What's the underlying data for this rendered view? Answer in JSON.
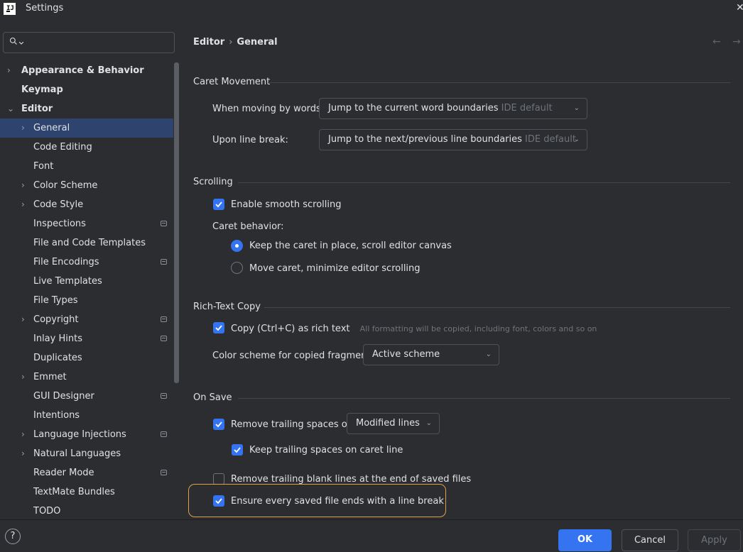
{
  "window": {
    "title": "Settings",
    "close": "✕"
  },
  "search": {
    "value": ""
  },
  "tree": [
    {
      "label": "Appearance & Behavior",
      "bold": true,
      "arrow": "›",
      "level": 0
    },
    {
      "label": "Keymap",
      "bold": true,
      "arrow": "",
      "level": 0
    },
    {
      "label": "Editor",
      "bold": true,
      "arrow": "⌄",
      "level": 0
    },
    {
      "label": "General",
      "arrow": "›",
      "level": 1,
      "selected": true
    },
    {
      "label": "Code Editing",
      "level": 1
    },
    {
      "label": "Font",
      "level": 1
    },
    {
      "label": "Color Scheme",
      "arrow": "›",
      "level": 1
    },
    {
      "label": "Code Style",
      "arrow": "›",
      "level": 1
    },
    {
      "label": "Inspections",
      "level": 1,
      "project": true
    },
    {
      "label": "File and Code Templates",
      "level": 1
    },
    {
      "label": "File Encodings",
      "level": 1,
      "project": true
    },
    {
      "label": "Live Templates",
      "level": 1
    },
    {
      "label": "File Types",
      "level": 1
    },
    {
      "label": "Copyright",
      "arrow": "›",
      "level": 1,
      "project": true
    },
    {
      "label": "Inlay Hints",
      "level": 1,
      "project": true
    },
    {
      "label": "Duplicates",
      "level": 1
    },
    {
      "label": "Emmet",
      "arrow": "›",
      "level": 1
    },
    {
      "label": "GUI Designer",
      "level": 1,
      "project": true
    },
    {
      "label": "Intentions",
      "level": 1
    },
    {
      "label": "Language Injections",
      "arrow": "›",
      "level": 1,
      "project": true
    },
    {
      "label": "Natural Languages",
      "arrow": "›",
      "level": 1
    },
    {
      "label": "Reader Mode",
      "level": 1,
      "project": true
    },
    {
      "label": "TextMate Bundles",
      "level": 1
    },
    {
      "label": "TODO",
      "level": 1
    }
  ],
  "breadcrumb": {
    "parent": "Editor",
    "separator": "›",
    "current": "General"
  },
  "nav": {
    "back": "←",
    "forward": "→"
  },
  "caret_movement": {
    "title": "Caret Movement",
    "words_label": "When moving by words:",
    "words_value": "Jump to the current word boundaries",
    "words_hint": "IDE default",
    "linebreak_label": "Upon line break:",
    "linebreak_value": "Jump to the next/previous line boundaries",
    "linebreak_hint": "IDE default"
  },
  "scrolling": {
    "title": "Scrolling",
    "smooth_label": "Enable smooth scrolling",
    "smooth_checked": true,
    "caret_behavior_label": "Caret behavior:",
    "radio_keep": "Keep the caret in place, scroll editor canvas",
    "radio_move": "Move caret, minimize editor scrolling",
    "selected": "keep"
  },
  "rich_text": {
    "title": "Rich-Text Copy",
    "copy_label": "Copy (Ctrl+C) as rich text",
    "copy_hint": "All formatting will be copied, including font, colors and so on",
    "copy_checked": true,
    "scheme_label": "Color scheme for copied fragment:",
    "scheme_value": "Active scheme"
  },
  "on_save": {
    "title": "On Save",
    "trailing_label": "Remove trailing spaces on:",
    "trailing_value": "Modified lines",
    "trailing_checked": true,
    "keep_caret_label": "Keep trailing spaces on caret line",
    "keep_caret_checked": true,
    "blank_lines_label": "Remove trailing blank lines at the end of saved files",
    "blank_lines_checked": false,
    "line_break_label": "Ensure every saved file ends with a line break",
    "line_break_checked": true
  },
  "footer": {
    "help": "?",
    "ok": "OK",
    "cancel": "Cancel",
    "apply": "Apply"
  },
  "colors": {
    "accent": "#3574f0",
    "selection": "#2e436e",
    "highlight": "#e0a04a",
    "background": "#2b2d30"
  }
}
